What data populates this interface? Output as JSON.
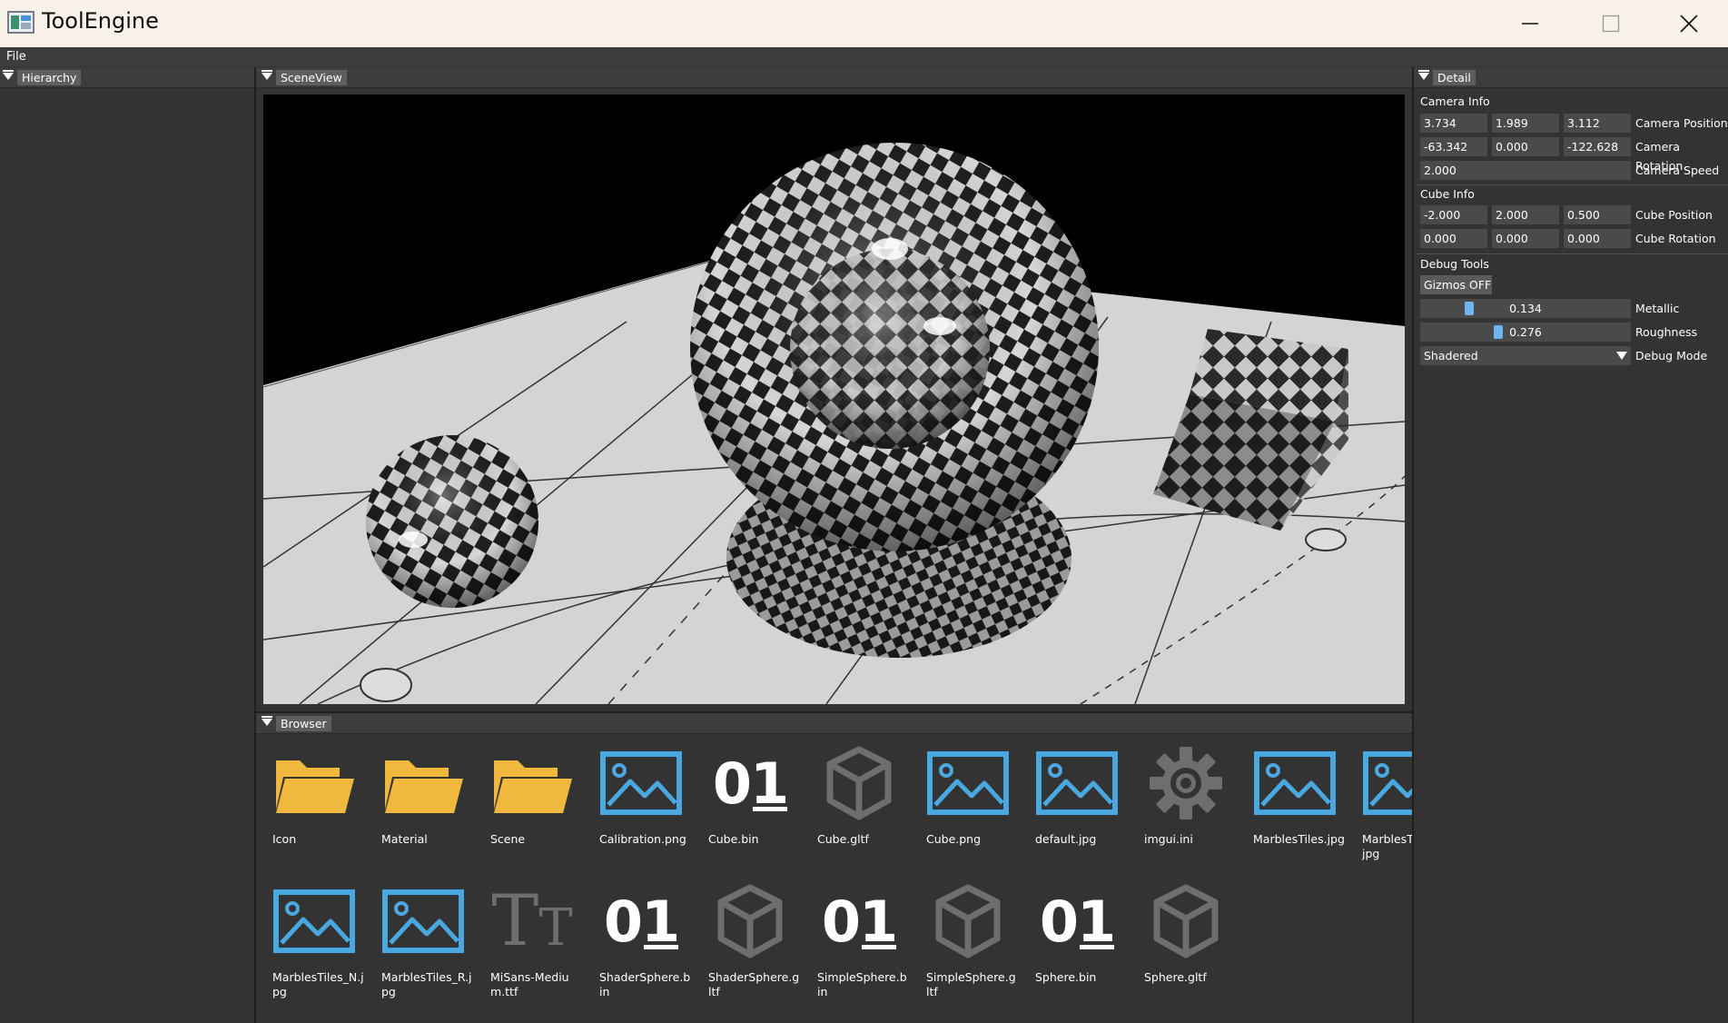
{
  "window": {
    "title": "ToolEngine",
    "controls": [
      "minimize",
      "maximize",
      "close"
    ]
  },
  "menubar": {
    "file": "File"
  },
  "panels": {
    "hierarchy": "Hierarchy",
    "sceneview": "SceneView",
    "browser": "Browser",
    "detail": "Detail"
  },
  "detail": {
    "camera_info": {
      "heading": "Camera Info",
      "position": {
        "label": "Camera Position",
        "values": [
          "3.734",
          "1.989",
          "3.112"
        ]
      },
      "rotation": {
        "label": "Camera Rotation",
        "values": [
          "-63.342",
          "0.000",
          "-122.628"
        ]
      },
      "speed": {
        "label": "Camera Speed",
        "value": "2.000"
      }
    },
    "cube_info": {
      "heading": "Cube Info",
      "position": {
        "label": "Cube Position",
        "values": [
          "-2.000",
          "2.000",
          "0.500"
        ]
      },
      "rotation": {
        "label": "Cube Rotation",
        "values": [
          "0.000",
          "0.000",
          "0.000"
        ]
      }
    },
    "debug_tools": {
      "heading": "Debug Tools",
      "gizmos_button": "Gizmos OFF",
      "metallic": {
        "label": "Metallic",
        "value": "0.134",
        "fraction": 0.134
      },
      "roughness": {
        "label": "Roughness",
        "value": "0.276",
        "fraction": 0.276
      },
      "debug_mode": {
        "label": "Debug Mode",
        "value": "Shadered"
      }
    }
  },
  "browser": {
    "items": [
      {
        "name": "Icon",
        "icon": "folder-icon"
      },
      {
        "name": "Material",
        "icon": "folder-icon"
      },
      {
        "name": "Scene",
        "icon": "folder-icon"
      },
      {
        "name": "Calibration.png",
        "icon": "image-icon"
      },
      {
        "name": "Cube.bin",
        "icon": "binary-icon"
      },
      {
        "name": "Cube.gltf",
        "icon": "cube-icon"
      },
      {
        "name": "Cube.png",
        "icon": "image-icon"
      },
      {
        "name": "default.jpg",
        "icon": "image-icon"
      },
      {
        "name": "imgui.ini",
        "icon": "gear-icon"
      },
      {
        "name": "MarblesTiles.jpg",
        "icon": "image-icon"
      },
      {
        "name": "MarblesTiles_M.jpg",
        "icon": "image-icon"
      },
      {
        "name": "MarblesTiles_N.jpg",
        "icon": "image-icon"
      },
      {
        "name": "MarblesTiles_R.jpg",
        "icon": "image-icon"
      },
      {
        "name": "MiSans-Medium.ttf",
        "icon": "font-icon"
      },
      {
        "name": "ShaderSphere.bin",
        "icon": "binary-icon"
      },
      {
        "name": "ShaderSphere.gltf",
        "icon": "cube-icon"
      },
      {
        "name": "SimpleSphere.bin",
        "icon": "binary-icon"
      },
      {
        "name": "SimpleSphere.gltf",
        "icon": "cube-icon"
      },
      {
        "name": "Sphere.bin",
        "icon": "binary-icon"
      },
      {
        "name": "Sphere.gltf",
        "icon": "cube-icon"
      }
    ],
    "binary_glyph": "01",
    "font_glyph": "Tт"
  },
  "colors": {
    "folder": "#f0b93e",
    "image": "#4aa8e0",
    "gray_icon": "#6e6e6e",
    "slider_thumb": "#6fb5f2"
  }
}
